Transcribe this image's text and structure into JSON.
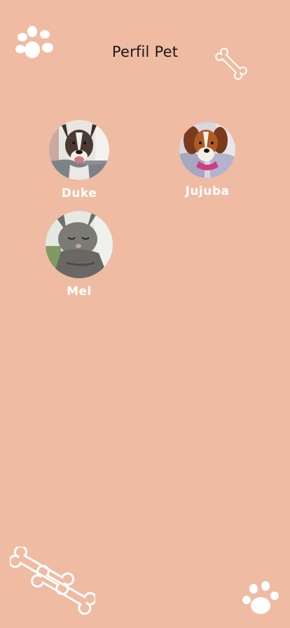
{
  "header": {
    "title": "Perfil Pet"
  },
  "pets": [
    {
      "name": "Duke"
    },
    {
      "name": "Jujuba"
    },
    {
      "name": "Mel"
    }
  ],
  "decorations": {
    "top_left": "paw-icon",
    "top_right": "bone-icon",
    "bottom_left": "bones-icon",
    "bottom_right": "paw-icon"
  },
  "colors": {
    "background": "#EFBBA2",
    "accent": "#FFFFFF",
    "title_text": "#1A1A1A"
  }
}
